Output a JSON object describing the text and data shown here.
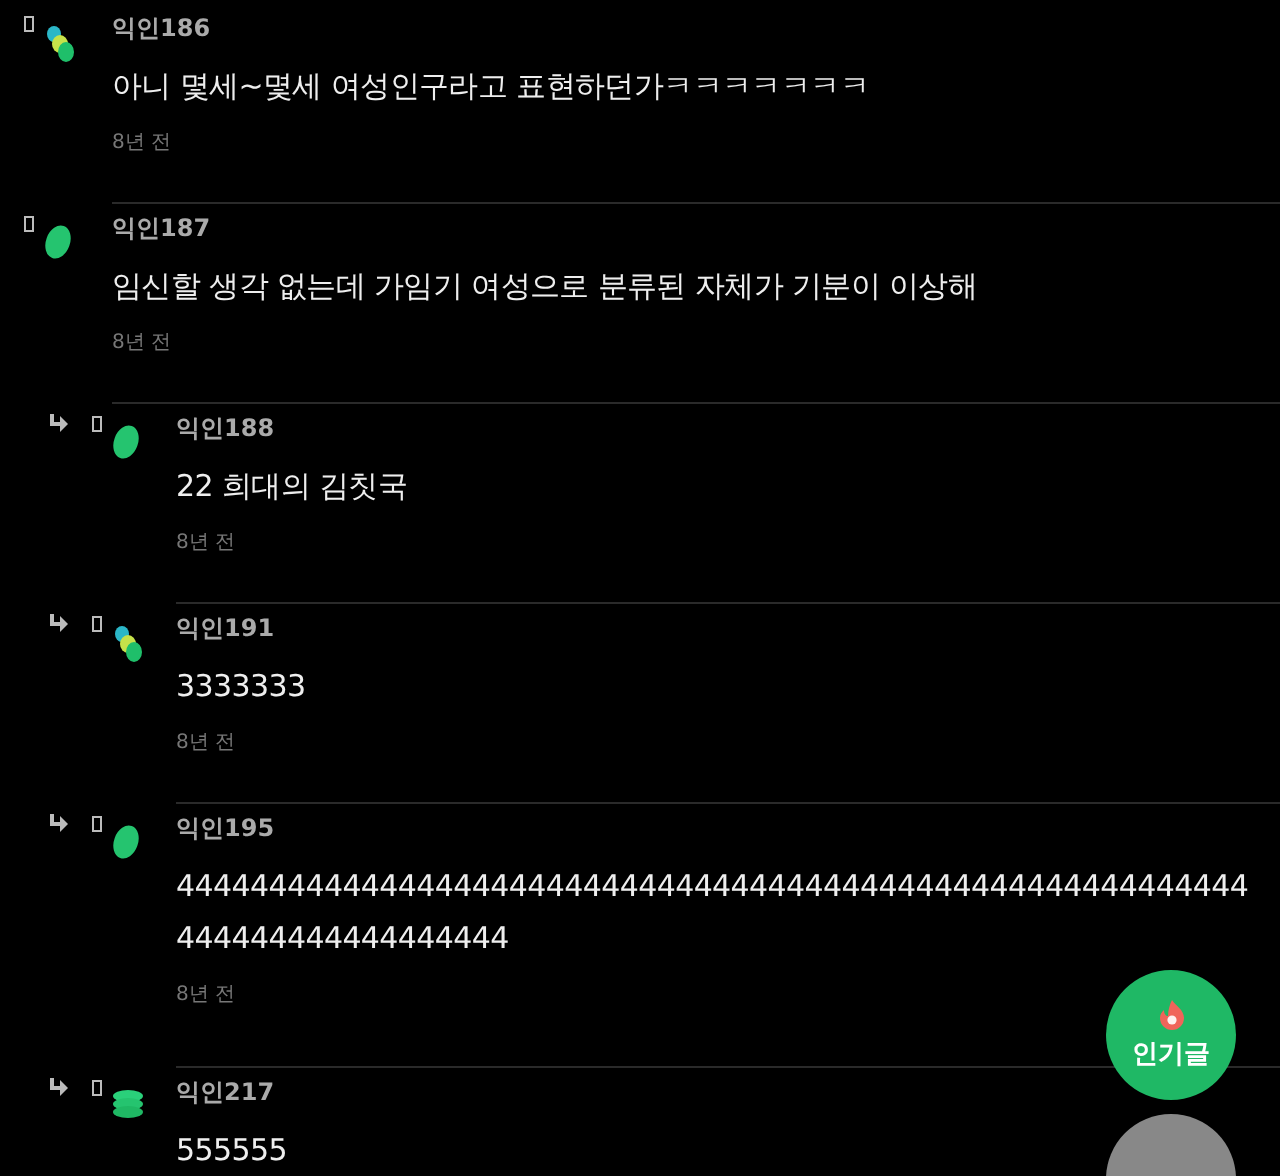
{
  "comments": [
    {
      "author": "익인186",
      "kind": "trio",
      "text": "아니 몇세~몇세 여성인구라고 표현하던가ㅋㅋㅋㅋㅋㅋㅋ",
      "time": "8년 전"
    },
    {
      "author": "익인187",
      "kind": "single",
      "text": "임신할 생각 없는데 가임기 여성으로 분류된 자체가 기분이 이상해",
      "time": "8년 전",
      "children": [
        {
          "author": "익인188",
          "kind": "single",
          "text": "22 희대의 김칫국",
          "time": "8년 전"
        },
        {
          "author": "익인191",
          "kind": "trio",
          "text": "3333333",
          "time": "8년 전"
        },
        {
          "author": "익인195",
          "kind": "single",
          "text": "4444444444444444444444444444444444444444444444444444444444444444444444444444",
          "time": "8년 전"
        },
        {
          "author": "익인217",
          "kind": "stack",
          "text": "555555"
        }
      ]
    }
  ],
  "fab": {
    "label": "인기글"
  }
}
